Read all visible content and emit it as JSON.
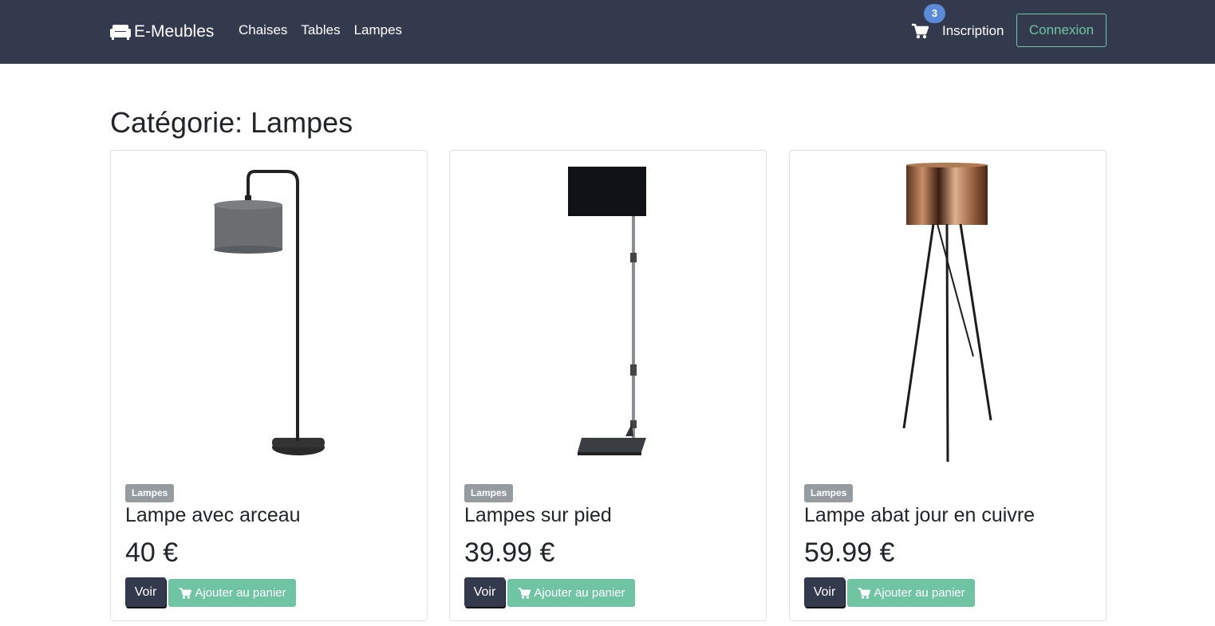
{
  "navbar": {
    "brand": "E-Meubles",
    "brand_icon": "couch-icon",
    "links": [
      {
        "label": "Chaises"
      },
      {
        "label": "Tables"
      },
      {
        "label": "Lampes"
      }
    ],
    "cart_count": "3",
    "signup_label": "Inscription",
    "login_label": "Connexion",
    "colors": {
      "bar": "#333a4d",
      "accent": "#6fc4a4",
      "badge": "#5b8ad8"
    }
  },
  "page": {
    "title": "Catégorie: Lampes"
  },
  "products": [
    {
      "category": "Lampes",
      "name": "Lampe avec arceau",
      "price": "40 €",
      "view_label": "Voir",
      "add_label": "Ajouter au panier"
    },
    {
      "category": "Lampes",
      "name": "Lampes sur pied",
      "price": "39.99 €",
      "view_label": "Voir",
      "add_label": "Ajouter au panier"
    },
    {
      "category": "Lampes",
      "name": "Lampe abat jour en cuivre",
      "price": "59.99 €",
      "view_label": "Voir",
      "add_label": "Ajouter au panier"
    }
  ]
}
